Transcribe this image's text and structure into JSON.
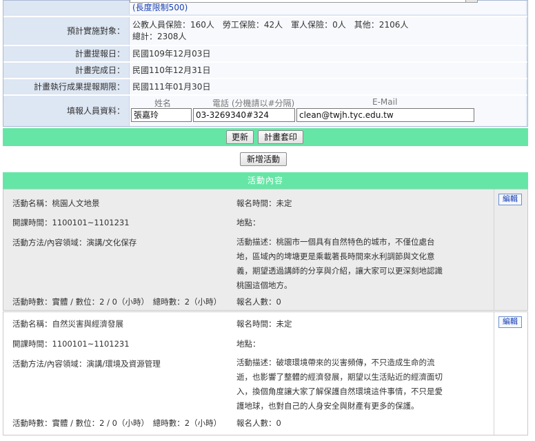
{
  "form": {
    "length_hint": "(長度限制500)",
    "target_label": "預計實施對象：",
    "target_line1": "公教人員保險：160人　勞工保險：42人　軍人保險：0人　其他：2106人",
    "target_line2": "總計：2308人",
    "proposal_label": "計畫提報日：",
    "proposal_date": "民國109年12月03日",
    "complete_label": "計畫完成日：",
    "complete_date": "民國110年12月31日",
    "deadline_label": "計畫執行成果提報期限：",
    "deadline_date": "民國111年01月30日",
    "person_label": "填報人員資料：",
    "name_header": "姓名",
    "phone_header": "電話 (分機請以#分隔)",
    "email_header": "E-Mail",
    "name_value": "張嘉玲",
    "phone_value": "03-3269340#324",
    "email_value": "clean@twjh.tyc.edu.tw"
  },
  "buttons": {
    "update": "更新",
    "print": "計畫套印",
    "add_activity": "新增活動"
  },
  "section_title": "活動內容",
  "activities": [
    {
      "name": "活動名稱：桃園人文地景",
      "signup_time": "報名時間：未定",
      "course_time": "開課時間：1100101~1101231",
      "place": "地點：",
      "method": "活動方法/內容領域：演講/文化保存",
      "desc_lines": [
        "活動描述：桃園市一個具有自然特色的城市，不僅位處台",
        "地，區域內的埤塘更是乘載著長時間來水利調節與文化意",
        "義，期望透過講師的分享與介紹，讓大家可以更深刻地認識",
        "桃園這個地方。"
      ],
      "hours": "活動時數：實體 / 數位：2 / 0（小時）　總時數：2（小時）",
      "signup_count": "報名人數：0",
      "edit": "編輯"
    },
    {
      "name": "活動名稱：自然災害與經濟發展",
      "signup_time": "報名時間：未定",
      "course_time": "開課時間：1100101~1101231",
      "place": "地點：",
      "method": "活動方法/內容領域：演講/環境及資源管理",
      "desc_lines": [
        "活動描述：破壞環境帶來的災害頻傳，不只造成生命的流",
        "逝，也影響了整體的經濟發展，期望以生活貼近的經濟面切",
        "入，換個角度讓大家了解保護自然環境這件事情，不只是愛",
        "護地球，也對自己的人身安全與財產有更多的保護。"
      ],
      "hours": "活動時數：實體 / 數位：2 / 0（小時）　總時數：2（小時）",
      "signup_count": "報名人數：0",
      "edit": "編輯"
    }
  ]
}
